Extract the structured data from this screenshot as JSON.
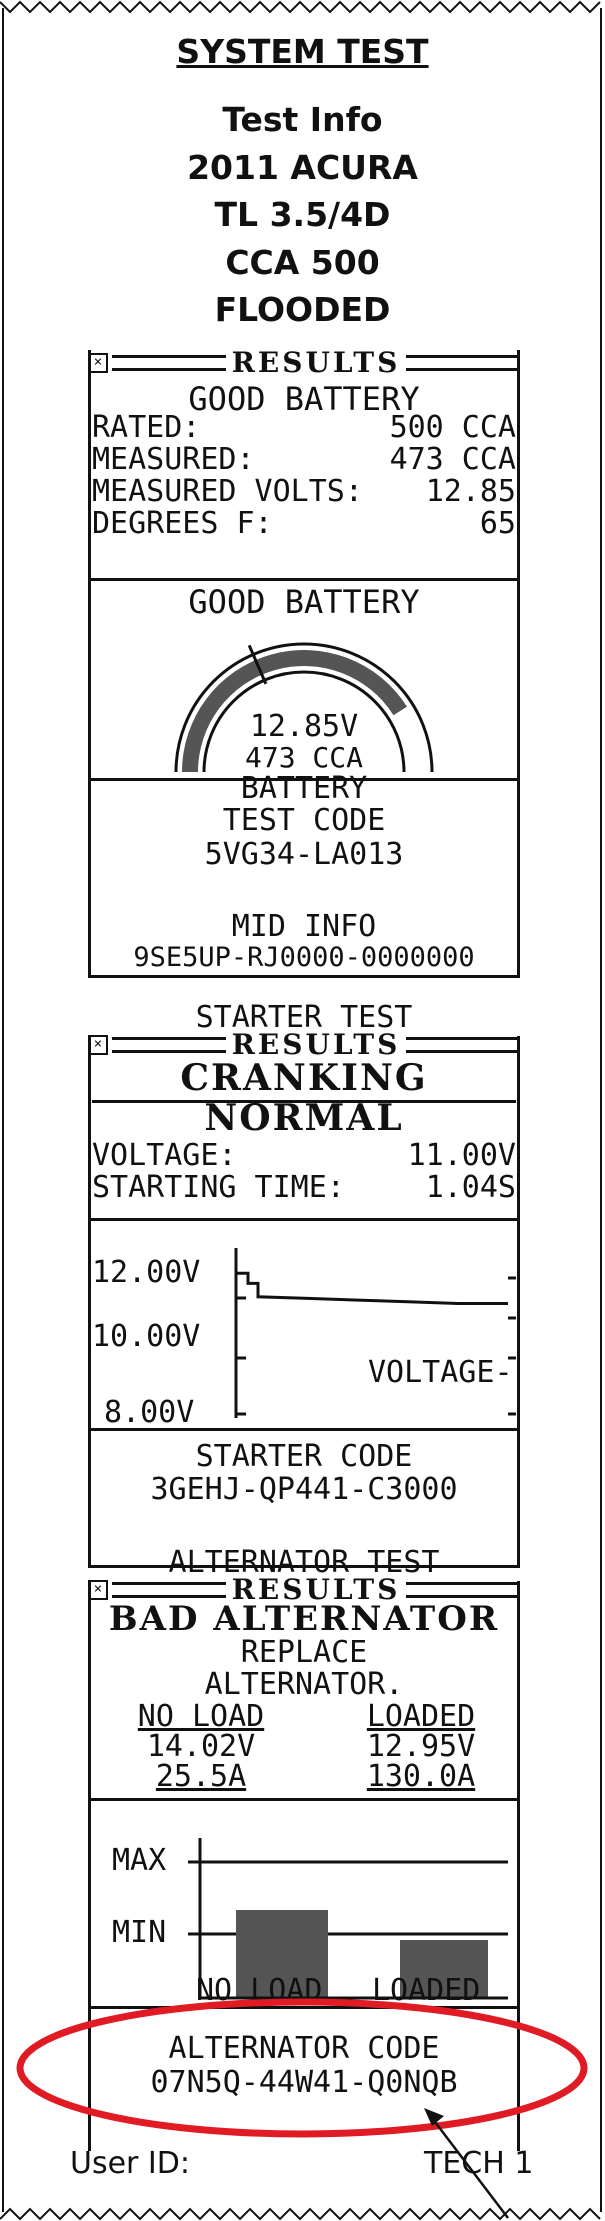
{
  "header": {
    "title": "SYSTEM TEST",
    "info_lines": [
      "Test Info",
      "2011 ACURA",
      "TL 3.5/4D",
      "CCA 500",
      "FLOODED"
    ]
  },
  "battery": {
    "results_label": "RESULTS",
    "status": "GOOD BATTERY",
    "rows": [
      {
        "label": "RATED:",
        "value": "500 CCA"
      },
      {
        "label": "MEASURED:",
        "value": "473 CCA"
      },
      {
        "label": "MEASURED VOLTS:",
        "value": "12.85"
      },
      {
        "label": "DEGREES F:",
        "value": "65"
      }
    ],
    "gauge_title": "GOOD BATTERY",
    "gauge_level": 0.82,
    "gauge_volts": "12.85V",
    "gauge_cca": "473 CCA",
    "code_label_1": "BATTERY",
    "code_label_2": "TEST CODE",
    "code": "5VG34-LA013",
    "mid_label": "MID INFO",
    "mid_value": "9SE5UP-RJ0000-0000000"
  },
  "starter": {
    "title": "STARTER TEST",
    "results_label": "RESULTS",
    "status": "CRANKING NORMAL",
    "rows": [
      {
        "label": "VOLTAGE:",
        "value": "11.00V"
      },
      {
        "label": "STARTING TIME:",
        "value": "1.04S"
      }
    ],
    "y_ticks": [
      "12.00V",
      "10.00V",
      "8.00V"
    ],
    "series_label": "VOLTAGE",
    "code_label": "STARTER CODE",
    "code": "3GEHJ-QP441-C3000"
  },
  "alternator": {
    "title": "ALTERNATOR TEST",
    "results_label": "RESULTS",
    "status": "BAD ALTERNATOR",
    "advice_1": "REPLACE",
    "advice_2": "ALTERNATOR.",
    "col_no_load": "NO LOAD",
    "col_loaded": "LOADED",
    "no_load_volts": "14.02V",
    "loaded_volts": "12.95V",
    "no_load_amps": "25.5A",
    "loaded_amps": "130.0A",
    "chart_max": "MAX",
    "chart_min": "MIN",
    "bar_no_load": "NO LOAD",
    "bar_loaded": "LOADED",
    "code_label": "ALTERNATOR CODE",
    "code": "07N5Q-44W41-Q0NQB"
  },
  "footer": {
    "user_label": "User ID:",
    "user_value": "TECH 1"
  },
  "colors": {
    "ink": "#111111",
    "highlight": "#e01b24",
    "bar_fill": "#555555"
  },
  "chart_data": [
    {
      "type": "line",
      "y_ticks": [
        "12.00V",
        "10.00V",
        "8.00V"
      ],
      "series": [
        {
          "name": "VOLTAGE",
          "values": [
            12.2,
            11.9,
            11.5,
            11.45,
            11.4,
            11.35,
            11.3,
            11.3
          ]
        }
      ]
    },
    {
      "type": "bar",
      "categories": [
        "NO LOAD",
        "LOADED"
      ],
      "y_ticks": [
        "MAX",
        "MIN"
      ]
    }
  ]
}
